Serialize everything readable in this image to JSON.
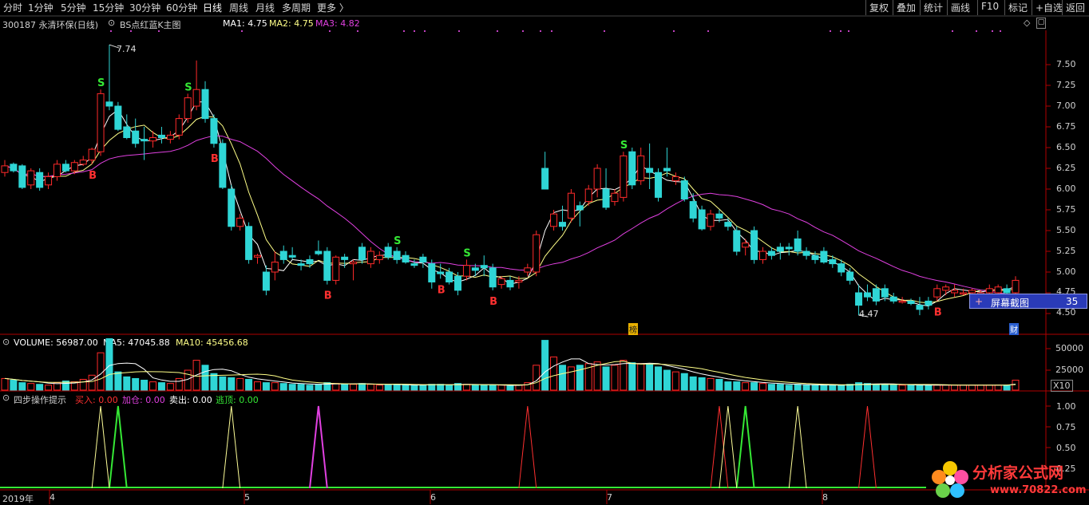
{
  "toolbar": {
    "periods": [
      "分时",
      "1分钟",
      "5分钟",
      "15分钟",
      "30分钟",
      "60分钟",
      "日线",
      "周线",
      "月线",
      "多周期",
      "更多 〉"
    ],
    "active_period": "日线",
    "right_buttons": [
      "复权",
      "叠加",
      "统计",
      "画线",
      "F10",
      "标记",
      "+自选",
      "返回"
    ]
  },
  "header": {
    "stock": "300187 永清环保(日线)",
    "indicator": "BS点红蓝K主图",
    "ma1": "MA1: 4.75",
    "ma2": "MA2: 4.75",
    "ma3": "MA3: 4.82"
  },
  "volume_header": {
    "title": "VOLUME: 56987.00",
    "ma5": "MA5: 47045.88",
    "ma10": "MA10: 45456.68"
  },
  "signal_header": {
    "title": "四步操作提示",
    "buy": "买入: 0.00",
    "add": "加仓: 0.00",
    "sell": "卖出: 0.00",
    "escape": "逃顶: 0.00"
  },
  "price_axis": {
    "ticks": [
      "7.50",
      "7.25",
      "7.00",
      "6.75",
      "6.50",
      "6.25",
      "6.00",
      "5.75",
      "5.50",
      "5.25",
      "5.00",
      "4.75",
      "4.50"
    ],
    "ylim": [
      4.47,
      7.74
    ]
  },
  "volume_axis": {
    "ticks": [
      "50000",
      "25000"
    ],
    "unit": "X10"
  },
  "signal_axis": {
    "ticks": [
      "1.00",
      "0.75",
      "0.50",
      "0.25"
    ]
  },
  "annotations": {
    "high": "7.74",
    "low": "4.47",
    "bang": "榜",
    "cai": "财"
  },
  "time_axis": [
    "2019年",
    "4",
    "5",
    "6",
    "7",
    "8"
  ],
  "tooltip": {
    "label": "屏幕截图",
    "value": "35"
  },
  "watermark": {
    "text": "分析家公式网",
    "url": "www.70822.com"
  },
  "colors": {
    "up": "#ff2a2a",
    "down": "#2fd6d6",
    "ma_white": "#ffffff",
    "ma_yellow": "#ffff88",
    "ma_magenta": "#e040e0",
    "buy": "#ff3030",
    "sell": "#35e835",
    "axis": "#b00000"
  },
  "chart_data": {
    "type": "candlestick",
    "candles": [
      [
        6.2,
        6.35,
        6.15,
        6.28
      ],
      [
        6.3,
        6.32,
        6.2,
        6.22
      ],
      [
        6.28,
        6.3,
        6.0,
        6.02
      ],
      [
        6.05,
        6.25,
        6.0,
        6.22
      ],
      [
        6.2,
        6.25,
        5.98,
        6.02
      ],
      [
        6.05,
        6.2,
        6.0,
        6.15
      ],
      [
        6.15,
        6.35,
        6.1,
        6.3
      ],
      [
        6.3,
        6.35,
        6.2,
        6.22
      ],
      [
        6.22,
        6.35,
        6.18,
        6.32
      ],
      [
        6.3,
        6.4,
        6.28,
        6.35
      ],
      [
        6.35,
        6.5,
        6.3,
        6.48
      ],
      [
        6.45,
        7.2,
        6.4,
        7.15
      ],
      [
        7.05,
        7.74,
        6.95,
        7.0
      ],
      [
        7.0,
        7.05,
        6.7,
        6.72
      ],
      [
        6.75,
        6.9,
        6.6,
        6.62
      ],
      [
        6.7,
        6.85,
        6.5,
        6.55
      ],
      [
        6.6,
        6.75,
        6.35,
        6.58
      ],
      [
        6.58,
        6.7,
        6.5,
        6.62
      ],
      [
        6.65,
        6.75,
        6.55,
        6.62
      ],
      [
        6.6,
        6.7,
        6.55,
        6.65
      ],
      [
        6.65,
        6.9,
        6.6,
        6.85
      ],
      [
        6.85,
        7.15,
        6.8,
        7.1
      ],
      [
        7.0,
        7.55,
        6.95,
        7.2
      ],
      [
        7.2,
        7.3,
        6.8,
        6.85
      ],
      [
        6.85,
        6.9,
        6.5,
        6.55
      ],
      [
        6.55,
        6.6,
        6.0,
        6.02
      ],
      [
        6.0,
        6.05,
        5.5,
        5.55
      ],
      [
        5.55,
        5.7,
        5.5,
        5.65
      ],
      [
        5.55,
        5.6,
        5.1,
        5.15
      ],
      [
        5.18,
        5.22,
        5.1,
        5.2
      ],
      [
        5.0,
        5.08,
        4.72,
        4.78
      ],
      [
        5.0,
        5.25,
        4.9,
        5.12
      ],
      [
        5.25,
        5.32,
        5.1,
        5.15
      ],
      [
        5.2,
        5.3,
        5.15,
        5.18
      ],
      [
        5.1,
        5.15,
        5.02,
        5.08
      ],
      [
        5.15,
        5.2,
        5.05,
        5.1
      ],
      [
        5.25,
        5.38,
        5.2,
        5.22
      ],
      [
        5.25,
        5.3,
        4.85,
        4.9
      ],
      [
        4.9,
        5.2,
        4.85,
        5.18
      ],
      [
        5.18,
        5.22,
        5.05,
        5.15
      ],
      [
        5.1,
        5.15,
        4.9,
        5.12
      ],
      [
        5.3,
        5.35,
        5.1,
        5.15
      ],
      [
        5.1,
        5.3,
        5.05,
        5.25
      ],
      [
        5.15,
        5.25,
        5.1,
        5.2
      ],
      [
        5.3,
        5.35,
        5.15,
        5.18
      ],
      [
        5.25,
        5.3,
        5.1,
        5.15
      ],
      [
        5.2,
        5.25,
        5.1,
        5.12
      ],
      [
        5.1,
        5.15,
        5.05,
        5.08
      ],
      [
        5.18,
        5.22,
        5.05,
        5.12
      ],
      [
        5.1,
        5.15,
        4.8,
        4.88
      ],
      [
        5.0,
        5.1,
        4.92,
        4.98
      ],
      [
        5.0,
        5.05,
        4.85,
        4.88
      ],
      [
        4.95,
        5.0,
        4.72,
        4.78
      ],
      [
        4.95,
        5.15,
        4.9,
        5.08
      ],
      [
        5.05,
        5.1,
        4.95,
        5.02
      ],
      [
        5.08,
        5.2,
        4.95,
        5.05
      ],
      [
        5.05,
        5.1,
        4.78,
        4.82
      ],
      [
        4.85,
        4.95,
        4.8,
        4.92
      ],
      [
        4.9,
        4.95,
        4.78,
        4.82
      ],
      [
        4.88,
        4.95,
        4.8,
        4.9
      ],
      [
        5.0,
        5.1,
        4.95,
        5.05
      ],
      [
        5.0,
        5.5,
        4.95,
        5.45
      ],
      [
        6.25,
        6.45,
        6.0,
        6.0
      ],
      [
        5.55,
        5.75,
        5.5,
        5.7
      ],
      [
        5.6,
        5.8,
        5.5,
        5.55
      ],
      [
        5.65,
        6.0,
        5.6,
        5.95
      ],
      [
        5.8,
        5.85,
        5.55,
        5.75
      ],
      [
        5.85,
        6.05,
        5.8,
        6.0
      ],
      [
        6.0,
        6.3,
        5.9,
        6.25
      ],
      [
        6.0,
        6.25,
        5.75,
        5.78
      ],
      [
        5.85,
        6.0,
        5.8,
        5.95
      ],
      [
        5.9,
        6.45,
        5.85,
        6.4
      ],
      [
        6.45,
        6.5,
        6.0,
        6.05
      ],
      [
        6.1,
        6.5,
        6.05,
        6.4
      ],
      [
        6.25,
        6.55,
        6.0,
        6.2
      ],
      [
        6.2,
        6.25,
        5.85,
        5.9
      ],
      [
        6.25,
        6.5,
        6.15,
        6.22
      ],
      [
        6.1,
        6.2,
        6.05,
        6.15
      ],
      [
        6.1,
        6.15,
        5.85,
        5.88
      ],
      [
        5.85,
        5.95,
        5.6,
        5.65
      ],
      [
        5.75,
        5.8,
        5.5,
        5.52
      ],
      [
        5.55,
        5.75,
        5.5,
        5.7
      ],
      [
        5.7,
        5.75,
        5.6,
        5.65
      ],
      [
        5.6,
        5.65,
        5.5,
        5.55
      ],
      [
        5.5,
        5.55,
        5.2,
        5.25
      ],
      [
        5.3,
        5.4,
        5.2,
        5.35
      ],
      [
        5.5,
        5.55,
        5.1,
        5.15
      ],
      [
        5.15,
        5.3,
        5.1,
        5.25
      ],
      [
        5.25,
        5.3,
        5.15,
        5.2
      ],
      [
        5.3,
        5.35,
        5.15,
        5.25
      ],
      [
        5.3,
        5.35,
        5.2,
        5.28
      ],
      [
        5.4,
        5.5,
        5.2,
        5.25
      ],
      [
        5.25,
        5.3,
        5.15,
        5.2
      ],
      [
        5.2,
        5.25,
        5.1,
        5.15
      ],
      [
        5.25,
        5.3,
        5.1,
        5.12
      ],
      [
        5.15,
        5.2,
        5.05,
        5.1
      ],
      [
        5.1,
        5.15,
        4.95,
        5.0
      ],
      [
        5.0,
        5.05,
        4.85,
        4.9
      ],
      [
        4.75,
        4.85,
        4.48,
        4.6
      ],
      [
        4.75,
        4.85,
        4.65,
        4.7
      ],
      [
        4.8,
        4.85,
        4.6,
        4.65
      ],
      [
        4.8,
        4.85,
        4.65,
        4.7
      ],
      [
        4.7,
        4.75,
        4.62,
        4.65
      ],
      [
        4.65,
        4.7,
        4.62,
        4.65
      ],
      [
        4.65,
        4.68,
        4.6,
        4.62
      ],
      [
        4.6,
        4.7,
        4.48,
        4.55
      ],
      [
        4.65,
        4.7,
        4.55,
        4.6
      ],
      [
        4.7,
        4.85,
        4.65,
        4.8
      ],
      [
        4.78,
        4.85,
        4.72,
        4.82
      ],
      [
        4.75,
        4.85,
        4.7,
        4.78
      ],
      [
        4.75,
        4.8,
        4.72,
        4.75
      ],
      [
        4.75,
        4.8,
        4.7,
        4.78
      ],
      [
        4.72,
        4.78,
        4.68,
        4.75
      ],
      [
        4.75,
        4.85,
        4.7,
        4.8
      ],
      [
        4.75,
        4.85,
        4.7,
        4.82
      ],
      [
        4.8,
        4.85,
        4.72,
        4.75
      ],
      [
        4.75,
        4.95,
        4.7,
        4.9
      ]
    ],
    "buy_signals": [
      10,
      24,
      37,
      50,
      56,
      107
    ],
    "sell_signals": [
      11,
      21,
      45,
      53,
      71
    ],
    "volume": [
      14000,
      12000,
      9000,
      8000,
      7000,
      6000,
      9000,
      11000,
      10000,
      13000,
      18000,
      45000,
      62000,
      22000,
      16000,
      14000,
      12000,
      10000,
      9000,
      8000,
      14000,
      24000,
      36000,
      30000,
      20000,
      16000,
      15000,
      14000,
      13000,
      10000,
      9000,
      9000,
      8000,
      7000,
      7000,
      6000,
      7000,
      9000,
      8000,
      7000,
      7000,
      8000,
      7000,
      6000,
      6000,
      7000,
      6000,
      6000,
      6000,
      7000,
      7000,
      6000,
      8000,
      7000,
      6000,
      6000,
      6000,
      6000,
      5000,
      6000,
      9000,
      30000,
      60000,
      40000,
      30000,
      28000,
      30000,
      32000,
      34000,
      28000,
      30000,
      36000,
      33000,
      32000,
      31000,
      28000,
      24000,
      22000,
      20000,
      16000,
      15000,
      14000,
      13000,
      10000,
      10000,
      9000,
      9000,
      8000,
      7000,
      7000,
      6000,
      7000,
      6000,
      6000,
      6000,
      6000,
      6000,
      7000,
      9000,
      8000,
      7000,
      7000,
      6000,
      6000,
      6000,
      6000,
      6000,
      6000,
      6000,
      6000,
      6000,
      6000,
      6000,
      6000,
      6000,
      6000,
      12000
    ],
    "signal_peaks": [
      {
        "name": "买入",
        "bars": [
          60,
          82,
          99
        ],
        "color": "#ff3030"
      },
      {
        "name": "加仓",
        "bars": [
          36
        ],
        "color": "#e040e0"
      },
      {
        "name": "卖出",
        "bars": [
          13,
          85
        ],
        "color": "#35e835"
      },
      {
        "name": "逃顶",
        "bars": [
          11,
          26,
          83,
          91
        ],
        "color": "#ffff99"
      }
    ]
  }
}
